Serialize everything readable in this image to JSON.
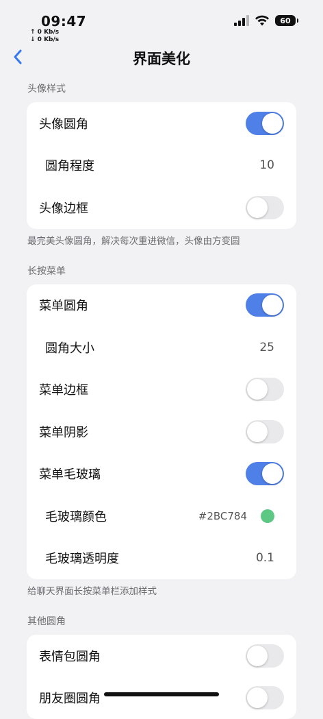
{
  "status_bar": {
    "time": "09:47",
    "upload_speed": "↑ 0 Kb/s",
    "download_speed": "↓ 0 Kb/s",
    "battery_level": "60"
  },
  "nav": {
    "title": "界面美化"
  },
  "sections": {
    "avatar": {
      "header": "头像样式",
      "footer": "最完美头像圆角，解决每次重进微信，头像由方变圆",
      "rows": {
        "round_corner": {
          "label": "头像圆角",
          "on": true
        },
        "corner_degree": {
          "label": "圆角程度",
          "value": "10"
        },
        "border": {
          "label": "头像边框",
          "on": false
        }
      }
    },
    "menu": {
      "header": "长按菜单",
      "footer": "给聊天界面长按菜单栏添加样式",
      "rows": {
        "round_corner": {
          "label": "菜单圆角",
          "on": true
        },
        "corner_size": {
          "label": "圆角大小",
          "value": "25"
        },
        "border": {
          "label": "菜单边框",
          "on": false
        },
        "shadow": {
          "label": "菜单阴影",
          "on": false
        },
        "frosted": {
          "label": "菜单毛玻璃",
          "on": true
        },
        "frosted_color": {
          "label": "毛玻璃颜色",
          "value": "#2BC784",
          "color": "#5DC784"
        },
        "frosted_opacity": {
          "label": "毛玻璃透明度",
          "value": "0.1"
        }
      }
    },
    "other": {
      "header": "其他圆角",
      "rows": {
        "sticker_corner": {
          "label": "表情包圆角",
          "on": false
        },
        "moments_corner": {
          "label": "朋友圈圆角",
          "on": false
        }
      }
    }
  },
  "colors": {
    "accent_toggle": "#4F80E8",
    "nav_back": "#3478F6",
    "background": "#F2F2F4"
  }
}
